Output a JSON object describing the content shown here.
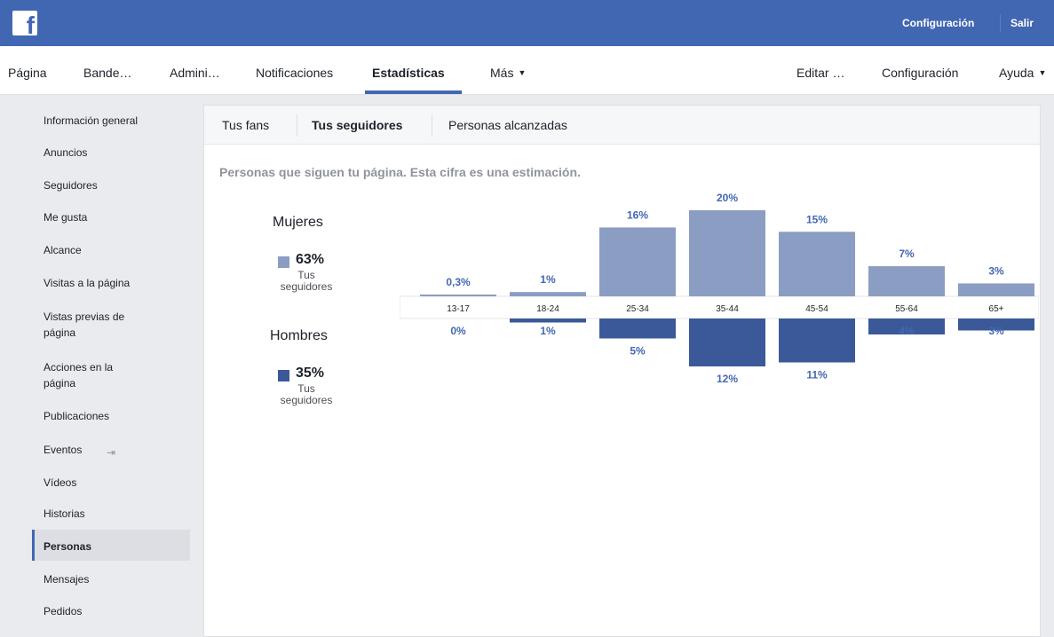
{
  "topbar": {
    "logo": "f",
    "settings_label": "Configuración",
    "logout_label": "Salir"
  },
  "nav": {
    "items": [
      "Página",
      "Bande…",
      "Admini…",
      "Notificaciones",
      "Estadísticas",
      "Más",
      "Editar …",
      "Configuración",
      "Ayuda"
    ],
    "active": "Estadísticas"
  },
  "sidebar": {
    "items": [
      "Información general",
      "Anuncios",
      "Seguidores",
      "Me gusta",
      "Alcance",
      "Visitas a la página",
      "Vistas previas de página",
      "Acciones en la página",
      "Publicaciones",
      "Eventos",
      "Vídeos",
      "Historias",
      "Personas",
      "Mensajes",
      "Pedidos"
    ],
    "active": "Personas",
    "event_icon": "export-icon"
  },
  "tabs": {
    "items": [
      "Tus fans",
      "Tus seguidores",
      "Personas alcanzadas"
    ],
    "active": "Tus seguidores"
  },
  "subtitle": "Personas que siguen tu página. Esta cifra es una estimación.",
  "legend": {
    "women": {
      "title": "Mujeres",
      "pct": "63%",
      "sub": "Tus seguidores",
      "color": "#8b9dc3"
    },
    "men": {
      "title": "Hombres",
      "pct": "35%",
      "sub": "Tus seguidores",
      "color": "#3b5998"
    }
  },
  "chart_data": {
    "type": "bar",
    "categories": [
      "13-17",
      "18-24",
      "25-34",
      "35-44",
      "45-54",
      "55-64",
      "65+"
    ],
    "series": [
      {
        "name": "Mujeres",
        "values": [
          0.3,
          1,
          16,
          20,
          15,
          7,
          3
        ],
        "labels": [
          "0,3%",
          "1%",
          "16%",
          "20%",
          "15%",
          "7%",
          "3%"
        ],
        "color": "#8b9dc3"
      },
      {
        "name": "Hombres",
        "values": [
          0,
          1,
          5,
          12,
          11,
          4,
          3
        ],
        "labels": [
          "0%",
          "1%",
          "5%",
          "12%",
          "11%",
          "4%",
          "3%"
        ],
        "color": "#3b5998"
      }
    ],
    "ylim": [
      0,
      20
    ]
  }
}
